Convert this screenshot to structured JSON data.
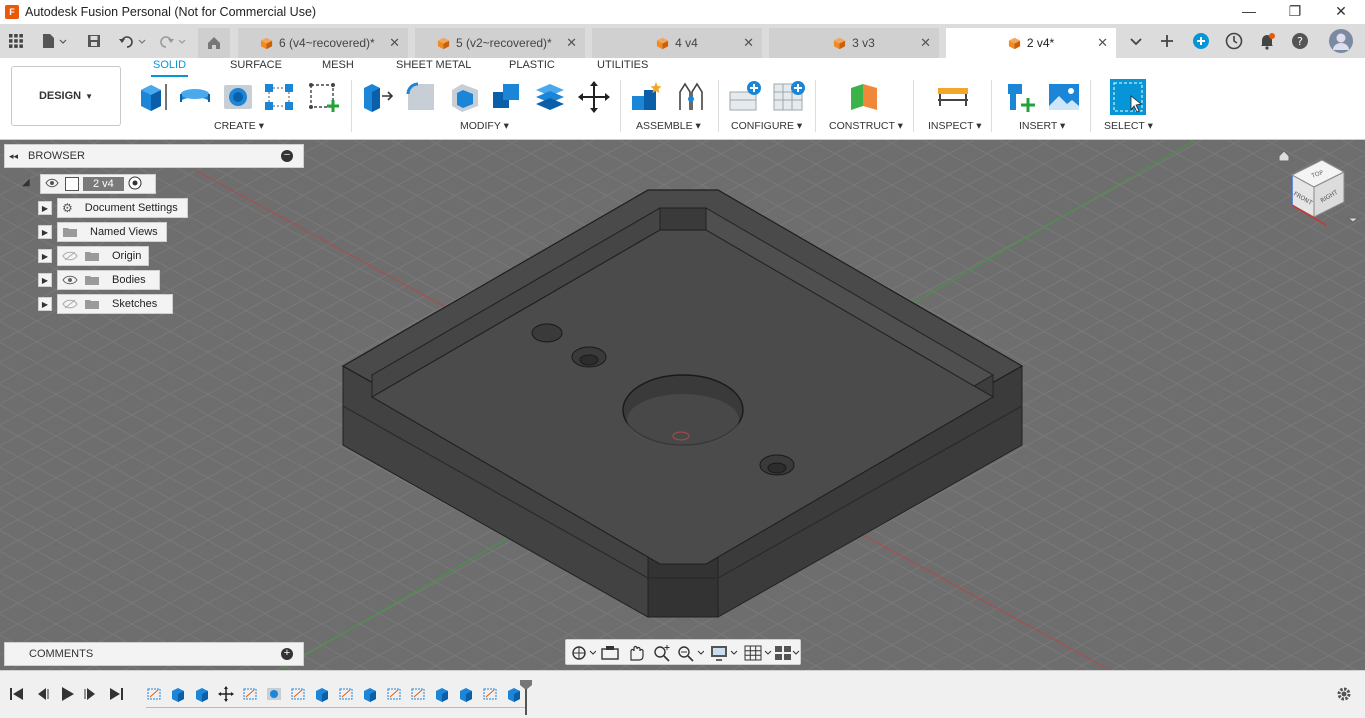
{
  "window": {
    "title": "Autodesk Fusion Personal (Not for Commercial Use)",
    "minimize": "—",
    "maximize": "❐",
    "close": "✕"
  },
  "tabs": [
    {
      "label": "6 (v4~recovered)*",
      "active": false
    },
    {
      "label": "5 (v2~recovered)*",
      "active": false
    },
    {
      "label": "4 v4",
      "active": false
    },
    {
      "label": "3 v3",
      "active": false
    },
    {
      "label": "2 v4*",
      "active": true
    }
  ],
  "toolbar": {
    "workspace_button": "DESIGN",
    "workspace_tabs": [
      "SOLID",
      "SURFACE",
      "MESH",
      "SHEET METAL",
      "PLASTIC",
      "UTILITIES"
    ],
    "groups": {
      "create": "CREATE",
      "modify": "MODIFY",
      "assemble": "ASSEMBLE",
      "configure": "CONFIGURE",
      "construct": "CONSTRUCT",
      "inspect": "INSPECT",
      "insert": "INSERT",
      "select": "SELECT"
    }
  },
  "browser": {
    "title": "BROWSER",
    "root": "2 v4",
    "items": [
      {
        "label": "Document Settings",
        "icon": "gear-icon"
      },
      {
        "label": "Named Views",
        "icon": "folder-icon"
      },
      {
        "label": "Origin",
        "icon": "folder-icon",
        "hidden": true
      },
      {
        "label": "Bodies",
        "icon": "folder-icon",
        "hidden": false
      },
      {
        "label": "Sketches",
        "icon": "folder-icon",
        "hidden": true
      }
    ]
  },
  "comments": {
    "title": "COMMENTS"
  },
  "viewcube": {
    "top": "TOP",
    "front": "FRONT",
    "right": "RIGHT"
  },
  "colors": {
    "accent": "#0696d7",
    "viewport_bg": "#6e6e6e",
    "model_top": "#4a4a4a",
    "model_side": "#3a3a3a",
    "orange": "#e8590c"
  }
}
